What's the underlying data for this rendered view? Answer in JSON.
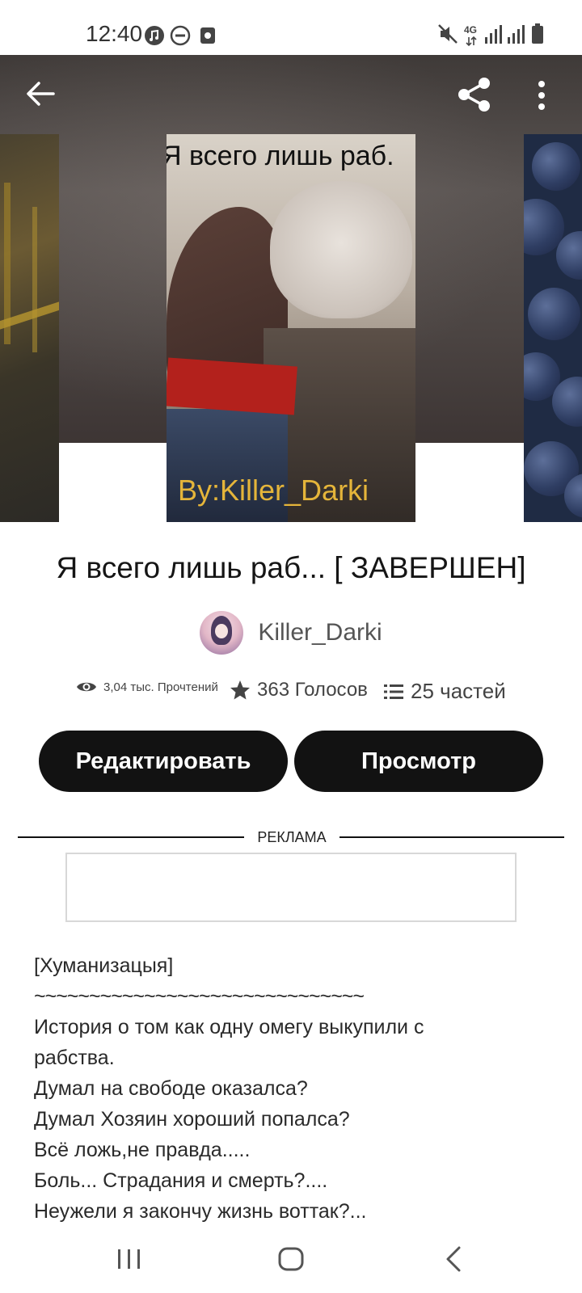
{
  "status_bar": {
    "time": "12:40",
    "network_label": "4G",
    "icons": [
      "music-icon",
      "dnd-icon",
      "screenshot-icon",
      "mute-icon",
      "signal-icon",
      "battery-icon"
    ]
  },
  "header": {
    "back_icon": "arrow-left-icon",
    "share_icon": "share-icon",
    "more_icon": "more-vertical-icon"
  },
  "cover": {
    "title_text": "Я всего лишь раб.",
    "author_text": "By:Killer_Darki"
  },
  "story": {
    "title": "Я всего лишь раб... [ ЗАВЕРШЕН]",
    "author": "Killer_Darki"
  },
  "stats": {
    "reads": "3,04 тыс. Прочтений",
    "votes": "363 Голосов",
    "parts": "25 частей"
  },
  "buttons": {
    "edit": "Редактировать",
    "view": "Просмотр"
  },
  "ad": {
    "label": "РЕКЛАМА"
  },
  "description": {
    "lines": [
      "[Хуманизацыя]",
      "~~~~~~~~~~~~~~~~~~~~~~~~~~~~~~",
      "История о том как одну омегу выкупили с",
      "рабства.",
      "Думал на свободе оказалса?",
      "Думал Хозяин хороший попалса?",
      "Всё ложь,не правда.....",
      "Боль... Страдания и смерть?....",
      "Неужели я закончу жизнь воттак?..."
    ]
  },
  "colors": {
    "button_bg": "#121212",
    "button_text": "#ffffff",
    "cover_author_gold": "#e5b53a",
    "scarf_red": "#b3211c"
  }
}
